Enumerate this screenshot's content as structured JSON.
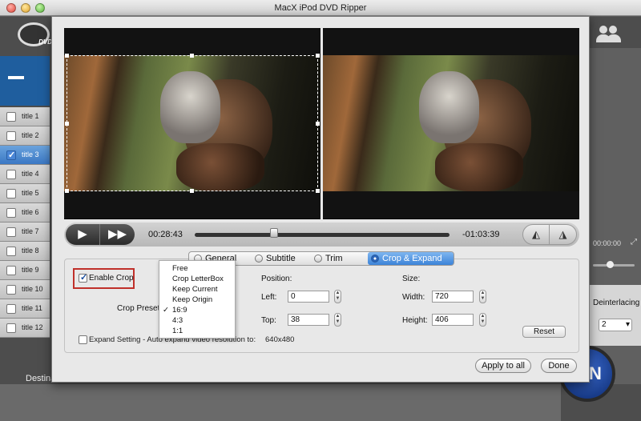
{
  "window": {
    "title": "MacX iPod DVD Ripper"
  },
  "app": {
    "logo_text": "DVD",
    "titles": [
      {
        "label": "title 1",
        "checked": false
      },
      {
        "label": "title 2",
        "checked": false
      },
      {
        "label": "title 3",
        "checked": true
      },
      {
        "label": "title 4",
        "checked": false
      },
      {
        "label": "title 5",
        "checked": false
      },
      {
        "label": "title 6",
        "checked": false
      },
      {
        "label": "title 7",
        "checked": false
      },
      {
        "label": "title 8",
        "checked": false
      },
      {
        "label": "title 9",
        "checked": false
      },
      {
        "label": "title 10",
        "checked": false
      },
      {
        "label": "title 11",
        "checked": false
      },
      {
        "label": "title 12",
        "checked": false
      }
    ],
    "preview_time": "00:00:00",
    "deinterlace_label": "Deinterlacing",
    "cpu_core": "2",
    "run_label": "N",
    "destination_label": "Destination Folder"
  },
  "player": {
    "elapsed": "00:28:43",
    "remaining": "-01:03:39",
    "play_icon": "▶",
    "ff_icon": "▶▶",
    "rotate_icon": "◭",
    "flip_icon": "◮",
    "seek_fraction": 0.31
  },
  "tabs": [
    {
      "label": "General",
      "active": false
    },
    {
      "label": "Subtitle",
      "active": false
    },
    {
      "label": "Trim",
      "active": false
    },
    {
      "label": "Crop & Expand",
      "active": true
    }
  ],
  "crop": {
    "enable_label": "Enable Crop",
    "enabled": true,
    "presets_label": "Crop Presets",
    "preset_options": [
      "Free",
      "Crop LetterBox",
      "Keep Current",
      "Keep Origin",
      "16:9",
      "4:3",
      "1:1"
    ],
    "selected_preset": "16:9",
    "position_label": "Position:",
    "left_label": "Left:",
    "left_value": "0",
    "top_label": "Top:",
    "top_value": "38",
    "size_label": "Size:",
    "width_label": "Width:",
    "width_value": "720",
    "height_label": "Height:",
    "height_value": "406",
    "reset_label": "Reset",
    "expand_label": "Expand Setting - Auto expand video resolution to:",
    "expand_value": "640x480",
    "expand_enabled": false
  },
  "actions": {
    "apply_all_label": "Apply to all",
    "done_label": "Done"
  }
}
